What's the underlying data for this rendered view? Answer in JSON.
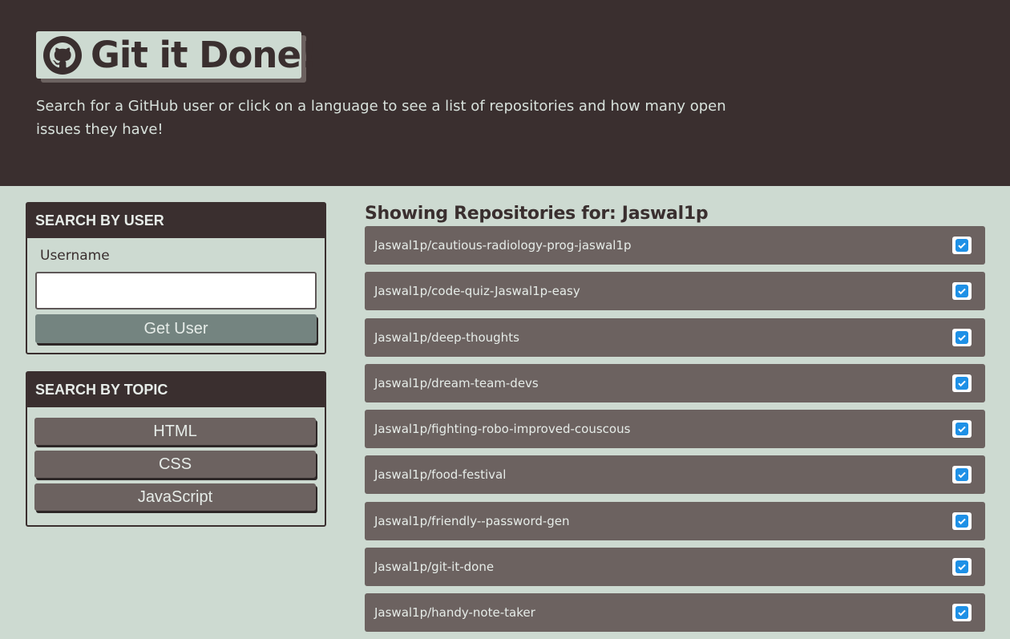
{
  "hero": {
    "logo_icon": "github-icon",
    "title": "Git it Done!",
    "subtitle": "Search for a GitHub user or click on a language to see a list of repositories and how many open issues they have!"
  },
  "user_search": {
    "header": "SEARCH BY USER",
    "label": "Username",
    "input_value": "",
    "button_label": "Get User"
  },
  "topic_search": {
    "header": "SEARCH BY TOPIC",
    "buttons": [
      "HTML",
      "CSS",
      "JavaScript"
    ]
  },
  "repos": {
    "heading": "Showing Repositories for: Jaswal1p",
    "status_icon": "checkmark-icon",
    "items": [
      "Jaswal1p/cautious-radiology-prog-jaswal1p",
      "Jaswal1p/code-quiz-Jaswal1p-easy",
      "Jaswal1p/deep-thoughts",
      "Jaswal1p/dream-team-devs",
      "Jaswal1p/fighting-robo-improved-couscous",
      "Jaswal1p/food-festival",
      "Jaswal1p/friendly--password-gen",
      "Jaswal1p/git-it-done",
      "Jaswal1p/handy-note-taker"
    ]
  },
  "colors": {
    "dark": "#3a2f2f",
    "mint": "#cddad1",
    "item": "#6c6260",
    "button": "#748480",
    "check": "#1e90e6"
  }
}
